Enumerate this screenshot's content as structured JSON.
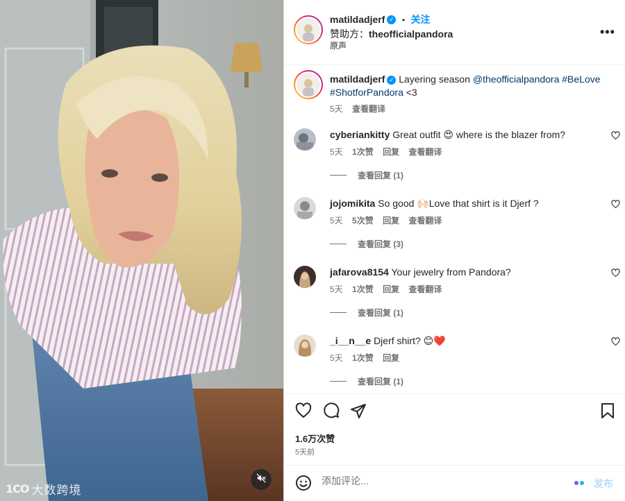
{
  "post": {
    "username": "matildadjerf",
    "follow_separator": "•",
    "follow_label": "关注",
    "sponsor_prefix": "赞助方：",
    "sponsor_name": "theofficialpandora",
    "audio_label": "原声",
    "more_label": "•••"
  },
  "caption": {
    "username": "matildadjerf",
    "text_before": "Layering season ",
    "mention": "@theofficialpandora",
    "hashtag1": "#BeLove",
    "hashtag2": "#ShotforPandora",
    "text_after": " <3",
    "time": "5天",
    "translate": "查看翻译"
  },
  "comments": [
    {
      "username": "cyberiankitty",
      "text": "Great outfit 😍 where is the blazer from?",
      "time": "5天",
      "likes": "1次赞",
      "reply": "回复",
      "translate": "查看翻译",
      "replies": "查看回复 (1)"
    },
    {
      "username": "jojomikita",
      "text": "So good 🙌🏻Love that shirt is it Djerf ?",
      "time": "5天",
      "likes": "5次赞",
      "reply": "回复",
      "translate": "查看翻译",
      "replies": "查看回复 (3)"
    },
    {
      "username": "jafarova8154",
      "text": "Your jewelry from Pandora?",
      "time": "5天",
      "likes": "1次赞",
      "reply": "回复",
      "translate": "查看翻译",
      "replies": "查看回复 (1)"
    },
    {
      "username": "_i__n__e",
      "text": "Djerf shirt? 😊❤️",
      "time": "5天",
      "likes": "1次赞",
      "reply": "回复",
      "translate": "",
      "replies": "查看回复 (1)"
    }
  ],
  "actions": {
    "like_count": "1.6万次赞",
    "posted_ago": "5天前"
  },
  "composer": {
    "placeholder": "添加评论...",
    "post_label": "发布"
  },
  "watermark": {
    "logo": "1CO",
    "text": "大数跨境"
  },
  "icons": {
    "verified": "verified-badge-icon",
    "more": "more-horizontal-icon",
    "heart": "heart-outline-icon",
    "comment": "comment-bubble-icon",
    "share": "paper-plane-icon",
    "save": "bookmark-icon",
    "emoji": "smiley-icon",
    "mute": "speaker-muted-icon"
  },
  "colors": {
    "accent": "#0095f6",
    "link": "#00376b",
    "muted_text": "#737373",
    "post_disabled": "#b2dffc"
  }
}
